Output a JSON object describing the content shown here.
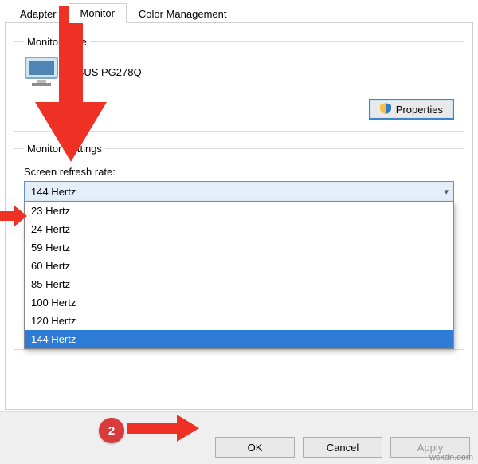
{
  "tabs": {
    "adapter": "Adapter",
    "monitor": "Monitor",
    "color": "Color Management"
  },
  "monitor_type": {
    "legend": "Monitor Type",
    "name": "ASUS PG278Q",
    "properties_btn": "Properties"
  },
  "monitor_settings": {
    "legend": "Monitor Settings",
    "refresh_label": "Screen refresh rate:",
    "selected": "144 Hertz",
    "options": [
      "23 Hertz",
      "24 Hertz",
      "59 Hertz",
      "60 Hertz",
      "85 Hertz",
      "100 Hertz",
      "120 Hertz",
      "144 Hertz"
    ]
  },
  "buttons": {
    "ok": "OK",
    "cancel": "Cancel",
    "apply": "Apply"
  },
  "annotation": {
    "step": "2"
  },
  "watermark": "wsxdn.com"
}
